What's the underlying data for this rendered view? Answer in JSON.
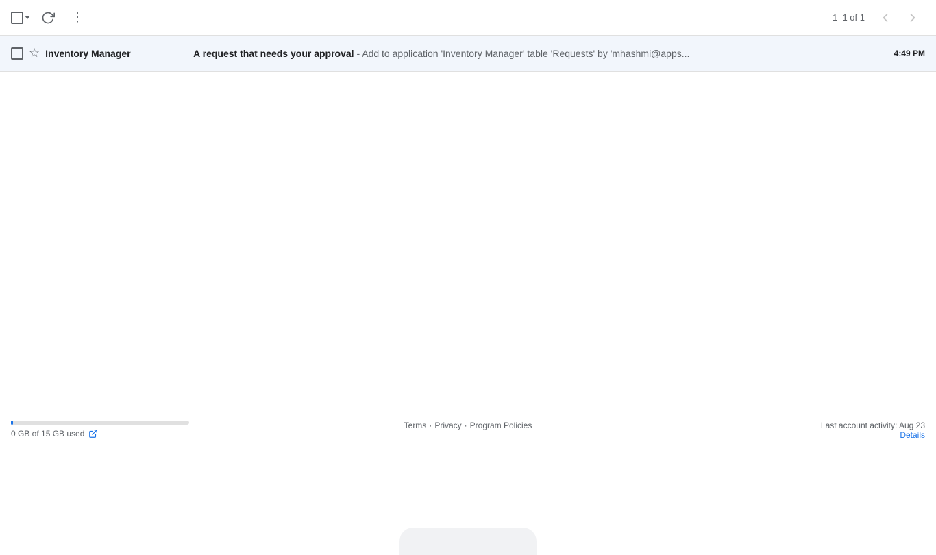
{
  "toolbar": {
    "refresh_label": "⟳",
    "more_label": "⋮",
    "pagination_text": "1–1 of 1",
    "prev_label": "‹",
    "next_label": "›"
  },
  "emails": [
    {
      "sender": "Inventory Manager",
      "subject": "A request that needs your approval",
      "snippet": " - Add to application 'Inventory Manager' table 'Requests' by 'mhashmi@apps...",
      "time": "4:49 PM",
      "read": false
    }
  ],
  "footer": {
    "storage_used": "0 GB of 15 GB used",
    "terms_label": "Terms",
    "privacy_label": "Privacy",
    "program_policies_label": "Program Policies",
    "last_activity_label": "Last account activity: Aug 23",
    "details_label": "Details",
    "separator": "·"
  }
}
